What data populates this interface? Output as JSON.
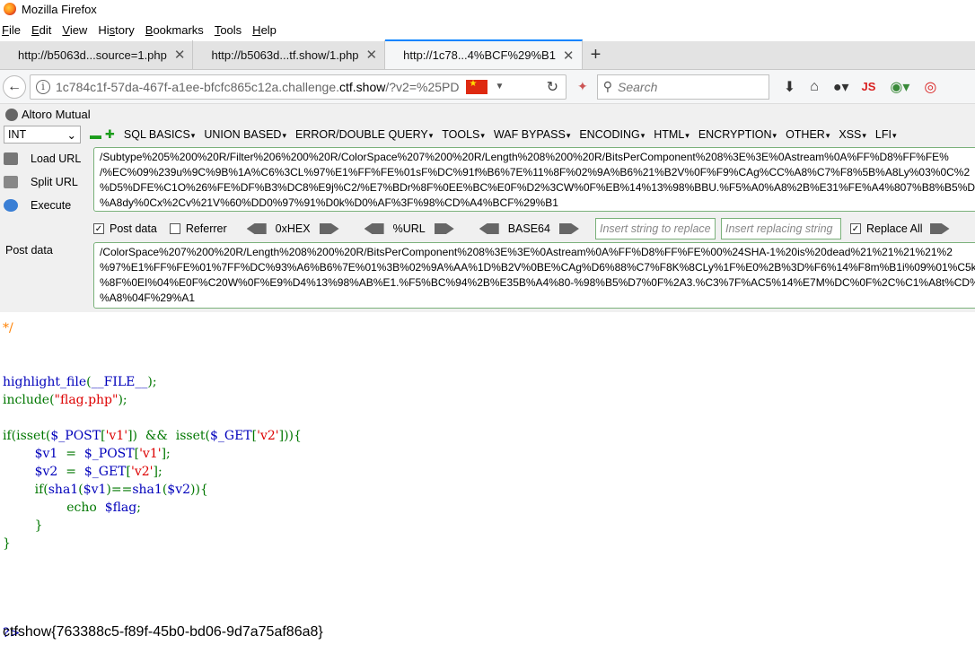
{
  "window": {
    "title": "Mozilla Firefox"
  },
  "menu": [
    {
      "pre": "",
      "u": "F",
      "post": "ile"
    },
    {
      "pre": "",
      "u": "E",
      "post": "dit"
    },
    {
      "pre": "",
      "u": "V",
      "post": "iew"
    },
    {
      "pre": "Hi",
      "u": "s",
      "post": "tory"
    },
    {
      "pre": "",
      "u": "B",
      "post": "ookmarks"
    },
    {
      "pre": "",
      "u": "T",
      "post": "ools"
    },
    {
      "pre": "",
      "u": "H",
      "post": "elp"
    }
  ],
  "tabs": [
    {
      "label": "http://b5063d...source=1.php",
      "active": false
    },
    {
      "label": "http://b5063d...tf.show/1.php",
      "active": false
    },
    {
      "label": "http://1c78...4%BCF%29%B1",
      "active": true
    }
  ],
  "nav": {
    "url_host": "1c784c1f-57da-467f-a1ee-bfcfc865c12a.challenge.",
    "url_domain": "ctf.show",
    "url_rest": "/?v2=%25PD",
    "search_placeholder": "Search",
    "js_label": "JS"
  },
  "hackbar": {
    "bookmark": "Altoro Mutual",
    "type_select": "INT",
    "menus": [
      "SQL BASICS",
      "UNION BASED",
      "ERROR/DOUBLE QUERY",
      "TOOLS",
      "WAF BYPASS",
      "ENCODING",
      "HTML",
      "ENCRYPTION",
      "OTHER",
      "XSS",
      "LFI"
    ],
    "load_url": "Load URL",
    "split_url": "Split URL",
    "execute": "Execute",
    "url_text": "/Subtype%205%200%20R/Filter%206%200%20R/ColorSpace%207%200%20R/Length%208%200%20R/BitsPerComponent%208%3E%3E%0Astream%0A%FF%D8%FF%FE%\n/%EC%09%239u%9C%9B%1A%C6%3CL%97%E1%FF%FE%01sF%DC%91f%B6%7E%11%8F%02%9A%B6%21%B2V%0F%F9%CAg%CC%A8%C7%F8%5B%A8Ly%03%0C%2\n%D5%DFE%C1O%26%FE%DF%B3%DC8%E9j%C2/%E7%BDr%8F%0EE%BC%E0F%D2%3CW%0F%EB%14%13%98%BBU.%F5%A0%A8%2B%E31%FE%A4%807%B8%B5%D7%\n%A8dy%0Cx%2Cv%21V%60%DD0%97%91%D0k%D0%AF%3F%98%CD%A4%BCF%29%B1",
    "post_data_chk": "Post data",
    "referrer_chk": "Referrer",
    "hex_label": "0xHEX",
    "url_label": "%URL",
    "base64_label": "BASE64",
    "replace_placeholder": "Insert string to replace",
    "replacing_placeholder": "Insert replacing string",
    "replace_all": "Replace All",
    "post_label": "Post data",
    "post_text": "/ColorSpace%207%200%20R/Length%208%200%20R/BitsPerComponent%208%3E%3E%0Astream%0A%FF%D8%FF%FE%00%24SHA-1%20is%20dead%21%21%21%21%2\n%97%E1%FF%FE%01%7FF%DC%93%A6%B6%7E%01%3B%02%9A%AA%1D%B2V%0BE%CAg%D6%88%C7%F8K%8CLy%1F%E0%2B%3D%F6%14%F8m%B1i%09%01%C5k\n%8F%0EI%04%E0F%C20W%0F%E9%D4%13%98%AB%E1.%F5%BC%94%2B%E35B%A4%80-%98%B5%D7%0F%2A3.%C3%7F%AC5%14%E7M%DC%0F%2C%C1%A8t%CD%\n%A8%04F%29%A1"
  },
  "code": {
    "comment_end": "*/",
    "l1_fn": "highlight_file",
    "l1_arg": "__FILE__",
    "l2_fn": "include",
    "l2_str": "\"flag.php\"",
    "l3_if": "if",
    "l3_isset": "isset",
    "l3_post": "$_POST",
    "l3_v1": "'v1'",
    "l3_get": "$_GET",
    "l3_v2": "'v2'",
    "l4_var": "$v1",
    "l4_src": "$_POST",
    "l4_key": "'v1'",
    "l5_var": "$v2",
    "l5_src": "$_GET",
    "l5_key": "'v2'",
    "l6_if": "if",
    "l6_sha": "sha1",
    "l6_v1": "$v1",
    "l6_v2": "$v2",
    "l7_echo": "echo",
    "l7_flag": "$flag",
    "close_tag": "?>"
  },
  "flag_output": "ctfshow{763388c5-f89f-45b0-bd06-9d7a75af86a8}"
}
